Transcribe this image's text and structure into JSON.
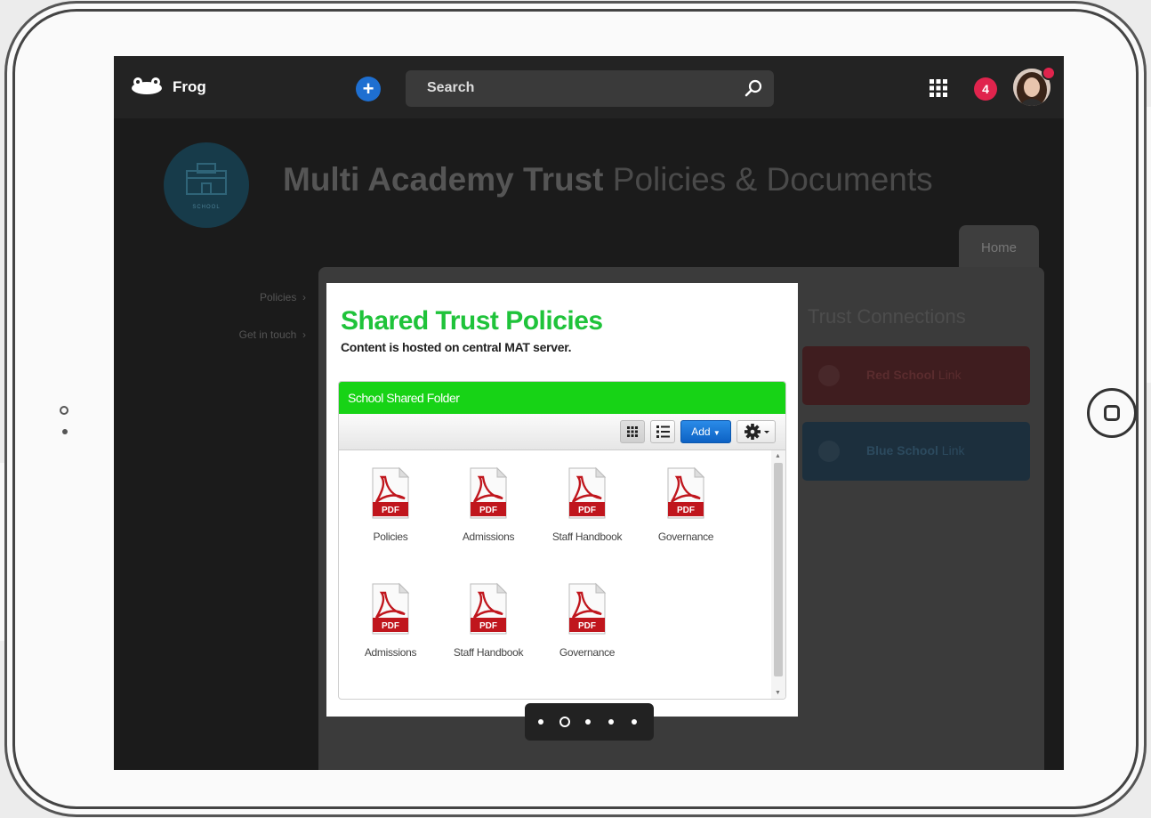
{
  "topbar": {
    "brand": "Frog",
    "search_placeholder": "Search",
    "notification_count": "4"
  },
  "page": {
    "title_bold": "Multi Academy Trust",
    "title_rest": " Policies & Documents",
    "school_logo_label": "SCHOOL",
    "home_tab": "Home"
  },
  "side_nav": {
    "items": [
      {
        "label": "Policies"
      },
      {
        "label": "Get in touch"
      }
    ]
  },
  "connections": {
    "title": "Trust Connections",
    "red_bold": "Red School",
    "red_rest": " Link",
    "blue_bold": "Blue School",
    "blue_rest": " Link"
  },
  "popup": {
    "title": "Shared Trust Policies",
    "subtitle": "Content is hosted on central MAT server.",
    "folder_title": "School Shared Folder",
    "add_label": "Add",
    "files": [
      {
        "label": "Policies",
        "type": "PDF"
      },
      {
        "label": "Admissions",
        "type": "PDF"
      },
      {
        "label": "Staff Handbook",
        "type": "PDF"
      },
      {
        "label": "Governance",
        "type": "PDF"
      },
      {
        "label": "Admissions",
        "type": "PDF"
      },
      {
        "label": "Staff Handbook",
        "type": "PDF"
      },
      {
        "label": "Governance",
        "type": "PDF"
      }
    ]
  },
  "pager": {
    "count": 5,
    "active_index": 1
  },
  "colors": {
    "accent_green": "#1fc33a",
    "folder_header": "#17d316",
    "add_button": "#0d62c4",
    "notification": "#e0244d",
    "pdf_red": "#c0161d"
  },
  "icons": {
    "frog": "frog-icon",
    "plus": "plus-icon",
    "search": "search-icon",
    "apps": "apps-grid-icon",
    "grid_view": "grid-view-icon",
    "list_view": "list-view-icon",
    "gear": "gear-icon",
    "pdf": "pdf-file-icon"
  }
}
